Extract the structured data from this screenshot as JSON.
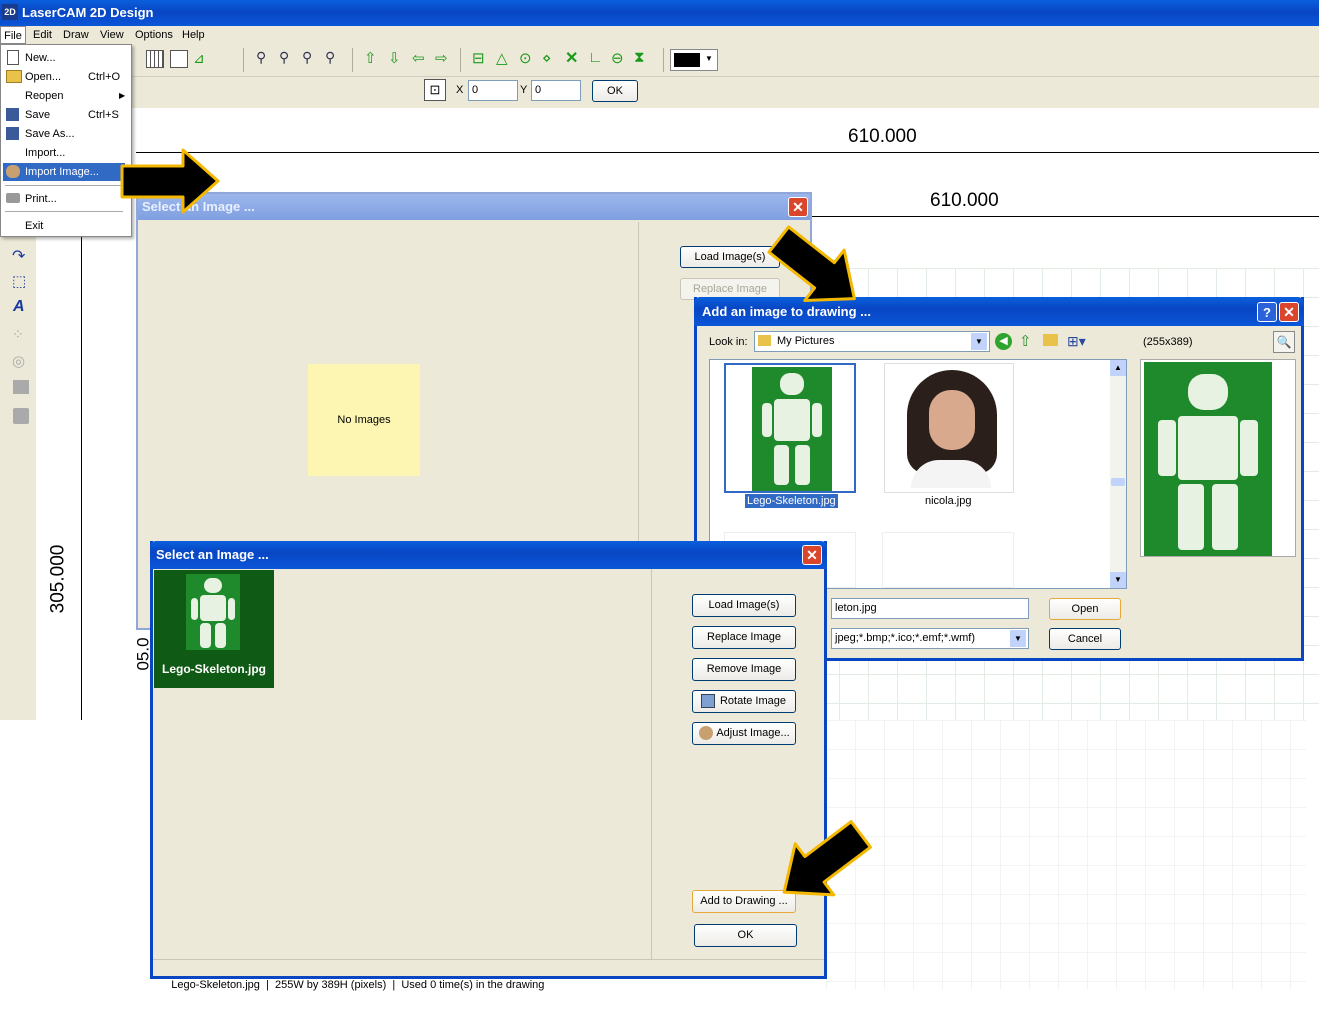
{
  "app": {
    "title": "LaserCAM 2D Design",
    "logo_text": "2D"
  },
  "menubar": [
    "File",
    "Edit",
    "Draw",
    "View",
    "Options",
    "Help"
  ],
  "file_menu": [
    {
      "label": "New...",
      "shortcut": ""
    },
    {
      "label": "Open...",
      "shortcut": "Ctrl+O"
    },
    {
      "label": "Reopen",
      "shortcut": ""
    },
    {
      "label": "Save",
      "shortcut": "Ctrl+S"
    },
    {
      "label": "Save As...",
      "shortcut": ""
    },
    {
      "label": "Import...",
      "shortcut": ""
    },
    {
      "label": "Import Image...",
      "shortcut": ""
    },
    {
      "label": "Print...",
      "shortcut": ""
    },
    {
      "label": "Exit",
      "shortcut": ""
    }
  ],
  "coord_bar": {
    "x_label": "X",
    "x_value": "0",
    "y_label": "Y",
    "y_value": "0",
    "ok_label": "OK"
  },
  "canvas": {
    "dim_top": "610.000",
    "dim_second": "610.000",
    "dim_vertical": "305.000",
    "dim_partial": "05.0"
  },
  "select_dialog_back": {
    "title": "Select an Image ...",
    "empty_text": "No Images",
    "load_label": "Load Image(s)",
    "replace_label": "Replace Image"
  },
  "add_dialog": {
    "title": "Add an image to drawing ...",
    "help_glyph": "?",
    "look_in_label": "Look in:",
    "look_in_value": "My Pictures",
    "preview_size": "(255x389)",
    "files": [
      {
        "name": "Lego-Skeleton.jpg",
        "selected": true
      },
      {
        "name": "nicola.jpg",
        "selected": false
      }
    ],
    "filename_value": "leton.jpg",
    "filetype_value": "jpeg;*.bmp;*.ico;*.emf;*.wmf)",
    "open_label": "Open",
    "cancel_label": "Cancel"
  },
  "select_dialog_front": {
    "title": "Select an Image ...",
    "thumb_caption": "Lego-Skeleton.jpg",
    "buttons": {
      "load": "Load Image(s)",
      "replace": "Replace Image",
      "remove": "Remove Image",
      "rotate": "Rotate Image",
      "adjust": "Adjust Image...",
      "add": "Add to Drawing ...",
      "ok": "OK"
    },
    "status": "Lego-Skeleton.jpg  |  255W by 389H (pixels)  |  Used 0 time(s) in the drawing"
  },
  "colors": {
    "title_blue": "#0846c4",
    "dialog_bg": "#ece9d8",
    "arrow_fill": "#000000",
    "arrow_outline": "#f5b800",
    "lego_green": "#1f8a2c"
  }
}
